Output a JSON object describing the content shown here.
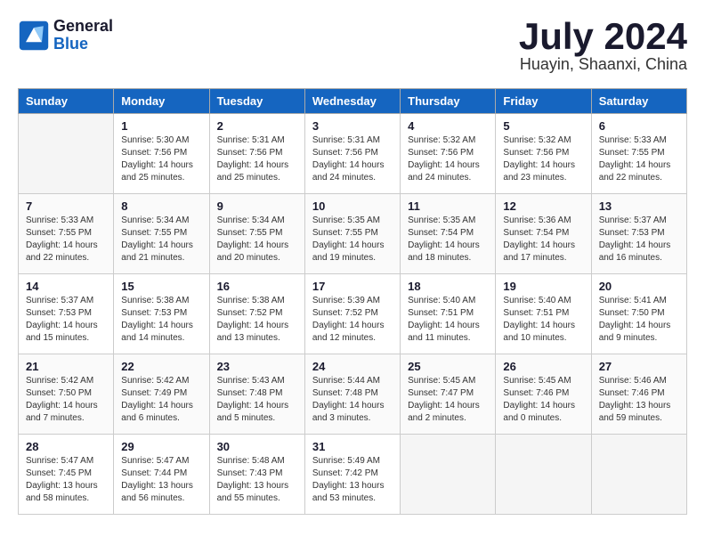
{
  "header": {
    "logo_general": "General",
    "logo_blue": "Blue",
    "month": "July 2024",
    "location": "Huayin, Shaanxi, China"
  },
  "calendar": {
    "headers": [
      "Sunday",
      "Monday",
      "Tuesday",
      "Wednesday",
      "Thursday",
      "Friday",
      "Saturday"
    ],
    "weeks": [
      [
        {
          "day": "",
          "info": ""
        },
        {
          "day": "1",
          "info": "Sunrise: 5:30 AM\nSunset: 7:56 PM\nDaylight: 14 hours\nand 25 minutes."
        },
        {
          "day": "2",
          "info": "Sunrise: 5:31 AM\nSunset: 7:56 PM\nDaylight: 14 hours\nand 25 minutes."
        },
        {
          "day": "3",
          "info": "Sunrise: 5:31 AM\nSunset: 7:56 PM\nDaylight: 14 hours\nand 24 minutes."
        },
        {
          "day": "4",
          "info": "Sunrise: 5:32 AM\nSunset: 7:56 PM\nDaylight: 14 hours\nand 24 minutes."
        },
        {
          "day": "5",
          "info": "Sunrise: 5:32 AM\nSunset: 7:56 PM\nDaylight: 14 hours\nand 23 minutes."
        },
        {
          "day": "6",
          "info": "Sunrise: 5:33 AM\nSunset: 7:55 PM\nDaylight: 14 hours\nand 22 minutes."
        }
      ],
      [
        {
          "day": "7",
          "info": "Sunrise: 5:33 AM\nSunset: 7:55 PM\nDaylight: 14 hours\nand 22 minutes."
        },
        {
          "day": "8",
          "info": "Sunrise: 5:34 AM\nSunset: 7:55 PM\nDaylight: 14 hours\nand 21 minutes."
        },
        {
          "day": "9",
          "info": "Sunrise: 5:34 AM\nSunset: 7:55 PM\nDaylight: 14 hours\nand 20 minutes."
        },
        {
          "day": "10",
          "info": "Sunrise: 5:35 AM\nSunset: 7:55 PM\nDaylight: 14 hours\nand 19 minutes."
        },
        {
          "day": "11",
          "info": "Sunrise: 5:35 AM\nSunset: 7:54 PM\nDaylight: 14 hours\nand 18 minutes."
        },
        {
          "day": "12",
          "info": "Sunrise: 5:36 AM\nSunset: 7:54 PM\nDaylight: 14 hours\nand 17 minutes."
        },
        {
          "day": "13",
          "info": "Sunrise: 5:37 AM\nSunset: 7:53 PM\nDaylight: 14 hours\nand 16 minutes."
        }
      ],
      [
        {
          "day": "14",
          "info": "Sunrise: 5:37 AM\nSunset: 7:53 PM\nDaylight: 14 hours\nand 15 minutes."
        },
        {
          "day": "15",
          "info": "Sunrise: 5:38 AM\nSunset: 7:53 PM\nDaylight: 14 hours\nand 14 minutes."
        },
        {
          "day": "16",
          "info": "Sunrise: 5:38 AM\nSunset: 7:52 PM\nDaylight: 14 hours\nand 13 minutes."
        },
        {
          "day": "17",
          "info": "Sunrise: 5:39 AM\nSunset: 7:52 PM\nDaylight: 14 hours\nand 12 minutes."
        },
        {
          "day": "18",
          "info": "Sunrise: 5:40 AM\nSunset: 7:51 PM\nDaylight: 14 hours\nand 11 minutes."
        },
        {
          "day": "19",
          "info": "Sunrise: 5:40 AM\nSunset: 7:51 PM\nDaylight: 14 hours\nand 10 minutes."
        },
        {
          "day": "20",
          "info": "Sunrise: 5:41 AM\nSunset: 7:50 PM\nDaylight: 14 hours\nand 9 minutes."
        }
      ],
      [
        {
          "day": "21",
          "info": "Sunrise: 5:42 AM\nSunset: 7:50 PM\nDaylight: 14 hours\nand 7 minutes."
        },
        {
          "day": "22",
          "info": "Sunrise: 5:42 AM\nSunset: 7:49 PM\nDaylight: 14 hours\nand 6 minutes."
        },
        {
          "day": "23",
          "info": "Sunrise: 5:43 AM\nSunset: 7:48 PM\nDaylight: 14 hours\nand 5 minutes."
        },
        {
          "day": "24",
          "info": "Sunrise: 5:44 AM\nSunset: 7:48 PM\nDaylight: 14 hours\nand 3 minutes."
        },
        {
          "day": "25",
          "info": "Sunrise: 5:45 AM\nSunset: 7:47 PM\nDaylight: 14 hours\nand 2 minutes."
        },
        {
          "day": "26",
          "info": "Sunrise: 5:45 AM\nSunset: 7:46 PM\nDaylight: 14 hours\nand 0 minutes."
        },
        {
          "day": "27",
          "info": "Sunrise: 5:46 AM\nSunset: 7:46 PM\nDaylight: 13 hours\nand 59 minutes."
        }
      ],
      [
        {
          "day": "28",
          "info": "Sunrise: 5:47 AM\nSunset: 7:45 PM\nDaylight: 13 hours\nand 58 minutes."
        },
        {
          "day": "29",
          "info": "Sunrise: 5:47 AM\nSunset: 7:44 PM\nDaylight: 13 hours\nand 56 minutes."
        },
        {
          "day": "30",
          "info": "Sunrise: 5:48 AM\nSunset: 7:43 PM\nDaylight: 13 hours\nand 55 minutes."
        },
        {
          "day": "31",
          "info": "Sunrise: 5:49 AM\nSunset: 7:42 PM\nDaylight: 13 hours\nand 53 minutes."
        },
        {
          "day": "",
          "info": ""
        },
        {
          "day": "",
          "info": ""
        },
        {
          "day": "",
          "info": ""
        }
      ]
    ]
  }
}
